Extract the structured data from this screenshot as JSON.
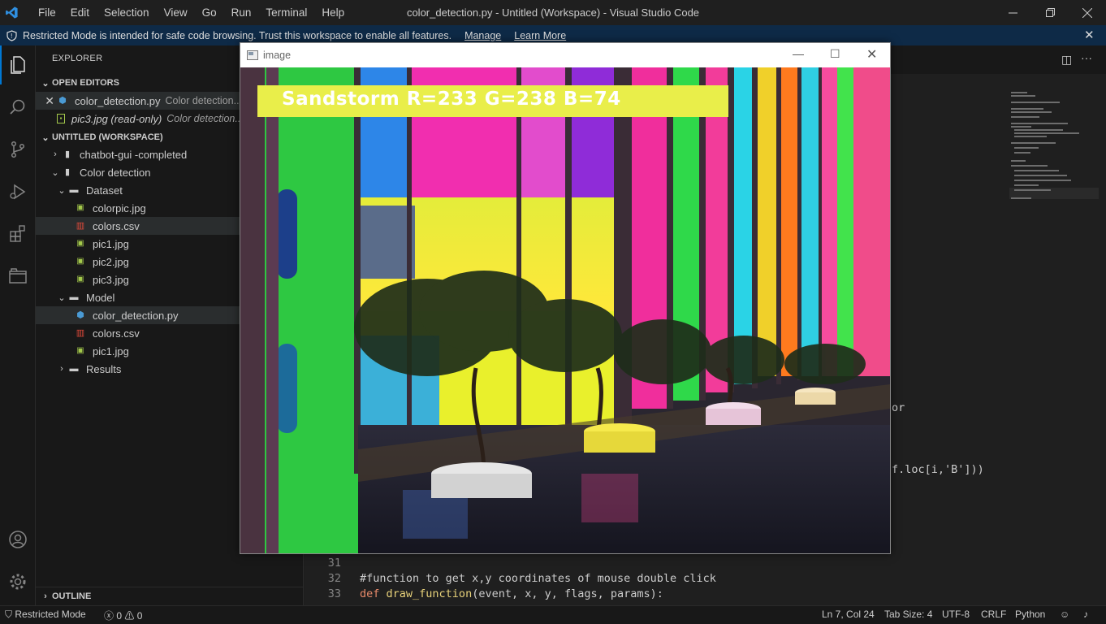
{
  "titlebar": {
    "menu": [
      "File",
      "Edit",
      "Selection",
      "View",
      "Go",
      "Run",
      "Terminal",
      "Help"
    ],
    "title": "color_detection.py - Untitled (Workspace) - Visual Studio Code"
  },
  "banner": {
    "text": "Restricted Mode is intended for safe code browsing. Trust this workspace to enable all features.",
    "manage": "Manage",
    "learn_more": "Learn More"
  },
  "sidebar": {
    "title": "EXPLORER",
    "open_editors": {
      "heading": "OPEN EDITORS",
      "items": [
        {
          "name": "color_detection.py",
          "desc": "Color detection..."
        },
        {
          "name": "pic3.jpg (read-only)",
          "desc": "Color detection..."
        }
      ]
    },
    "workspace": {
      "heading": "UNTITLED (WORKSPACE)",
      "items": [
        {
          "label": "chatbot-gui -completed"
        },
        {
          "label": "Color detection"
        },
        {
          "label": "Dataset"
        },
        {
          "label": "colorpic.jpg"
        },
        {
          "label": "colors.csv"
        },
        {
          "label": "pic1.jpg"
        },
        {
          "label": "pic2.jpg"
        },
        {
          "label": "pic3.jpg"
        },
        {
          "label": "Model"
        },
        {
          "label": "color_detection.py"
        },
        {
          "label": "colors.csv"
        },
        {
          "label": "pic1.jpg"
        },
        {
          "label": "Results"
        }
      ]
    },
    "outline": "OUTLINE"
  },
  "editor": {
    "partial_lines": [
      {
        "text": "or"
      },
      {
        "text": "f.loc[i,'B']))"
      }
    ],
    "lines": [
      {
        "num": "31",
        "text": ""
      },
      {
        "num": "32",
        "text": "#function to get x,y coordinates of mouse double click"
      },
      {
        "num": "33",
        "kw": "def",
        "fn": "draw_function",
        "rest": "(event, x, y, flags, params):"
      }
    ]
  },
  "image_window": {
    "title": "image",
    "label": "Sandstorm R=233 G=238 B=74",
    "label_color": "#e9ee4a"
  },
  "statusbar": {
    "mode": "Restricted Mode",
    "errors": "0",
    "warnings": "0",
    "position": "Ln 7, Col 24",
    "tab_size": "Tab Size: 4",
    "encoding": "UTF-8",
    "eol": "CRLF",
    "language": "Python"
  }
}
